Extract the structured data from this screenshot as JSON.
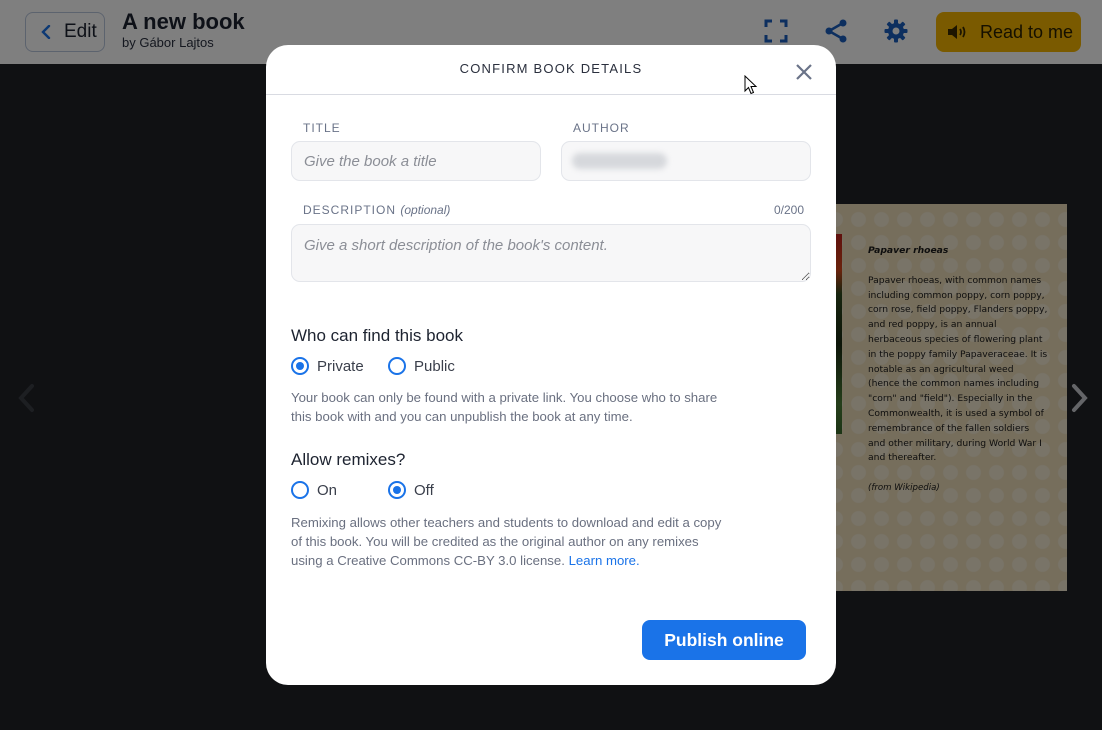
{
  "topbar": {
    "edit_label": "Edit",
    "book_title": "A new book",
    "book_author": "by Gábor Lajtos",
    "icons": [
      "fullscreen-icon",
      "share-icon",
      "settings-icon"
    ],
    "read_to_me_label": "Read to me",
    "read_to_me_color": "#f4b400"
  },
  "book_page": {
    "heading": "Papaver rhoeas",
    "body": "Papaver rhoeas, with common names including common poppy, corn poppy, corn rose, field poppy, Flanders poppy, and red poppy, is an annual herbaceous species of flowering plant in the poppy family Papaveraceae. It is notable as an agricultural weed (hence the common names including \"corn\" and \"field\"). Especially in the Commonwealth, it is used a symbol of remembrance of the fallen soldiers and other military, during World War I and thereafter.",
    "source": "(from Wikipedia)"
  },
  "modal": {
    "title": "CONFIRM BOOK DETAILS",
    "title_field": {
      "label": "TITLE",
      "placeholder": "Give the book a title",
      "value": ""
    },
    "author_field": {
      "label": "AUTHOR",
      "value_blurred": true
    },
    "description_field": {
      "label": "DESCRIPTION",
      "label_suffix": "(optional)",
      "placeholder": "Give a short description of the book's content.",
      "value": "",
      "counter": "0/200"
    },
    "visibility": {
      "heading": "Who can find this book",
      "options": [
        {
          "label": "Private",
          "selected": true
        },
        {
          "label": "Public",
          "selected": false
        }
      ],
      "help": "Your book can only be found with a private link. You choose who to share this book with and you can unpublish the book at any time."
    },
    "remixes": {
      "heading": "Allow remixes?",
      "options": [
        {
          "label": "On",
          "selected": false
        },
        {
          "label": "Off",
          "selected": true
        }
      ],
      "help": "Remixing allows other teachers and students to download and edit a copy of this book. You will be credited as the original author on any remixes using a Creative Commons CC-BY 3.0 license.",
      "link_label": "Learn more."
    },
    "publish_label": "Publish online",
    "accent_color": "#1a73e8"
  }
}
